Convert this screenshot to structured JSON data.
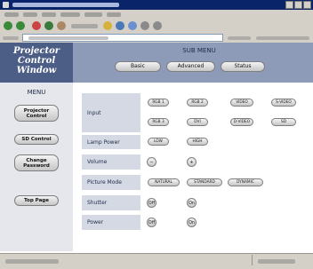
{
  "header": {
    "logo_text": "Projector\nControl\nWindow",
    "submenu_title": "SUB MENU",
    "tabs": [
      {
        "label": "Basic"
      },
      {
        "label": "Advanced"
      },
      {
        "label": "Status"
      }
    ]
  },
  "sidebar": {
    "title": "MENU",
    "items": [
      {
        "label": "Projector Control"
      },
      {
        "label": "SD Control"
      },
      {
        "label": "Change Password"
      },
      {
        "label": "Top Page"
      }
    ]
  },
  "controls": {
    "input": {
      "label": "Input",
      "buttons": [
        "RGB 1",
        "RGB 2",
        "VIDEO",
        "S-VIDEO",
        "RGB 3",
        "DVI",
        "D-VIDEO",
        "SD"
      ]
    },
    "lamp_power": {
      "label": "Lamp Power",
      "buttons": [
        "LOW",
        "HIGH"
      ]
    },
    "volume": {
      "label": "Volume",
      "buttons": [
        "−",
        "+"
      ]
    },
    "picture_mode": {
      "label": "Picture Mode",
      "buttons": [
        "NATURAL",
        "STANDARD",
        "DYNAMIC"
      ]
    },
    "shutter": {
      "label": "Shutter",
      "buttons": [
        "Off",
        "On"
      ]
    },
    "power": {
      "label": "Power",
      "buttons": [
        "Off",
        "On"
      ]
    }
  },
  "colors": {
    "title_bar": "#0a246a",
    "header_band": "#8e9bb8",
    "logo_panel": "#4c5d86",
    "row_label_bg": "#d5d9e3"
  }
}
